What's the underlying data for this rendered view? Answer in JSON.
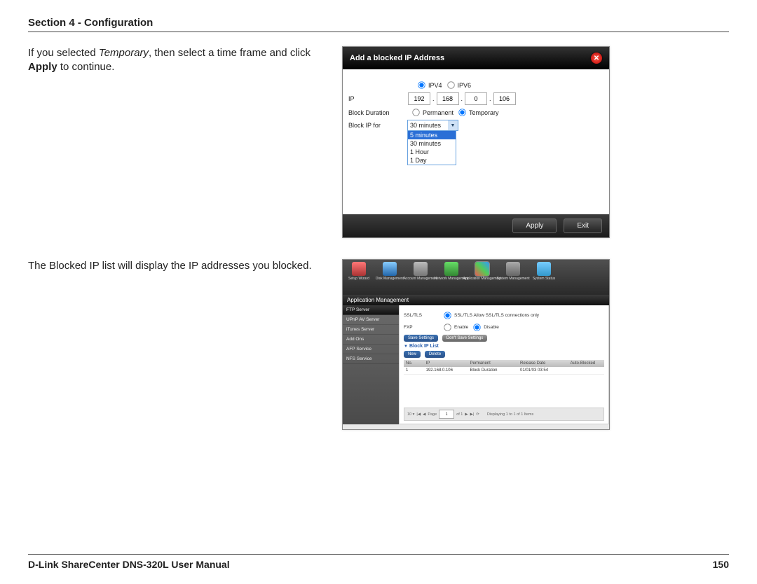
{
  "header": {
    "title": "Section 4 - Configuration"
  },
  "para1": {
    "pre": "If you selected ",
    "temp": "Temporary",
    "mid": ", then select a time frame and click ",
    "apply": "Apply",
    "post": " to continue."
  },
  "para2": "The Blocked IP list will display the IP addresses you blocked.",
  "dialog": {
    "title": "Add a blocked IP Address",
    "ipv4": "IPV4",
    "ipv6": "IPV6",
    "ip_label": "IP",
    "ip": [
      "192",
      "168",
      "0",
      "106"
    ],
    "bd_label": "Block Duration",
    "perm": "Permanent",
    "tempr": "Temporary",
    "bif_label": "Block IP for",
    "selected": "30 minutes",
    "options": [
      "5 minutes",
      "30 minutes",
      "1 Hour",
      "1 Day"
    ],
    "apply": "Apply",
    "exit": "Exit"
  },
  "shot2": {
    "subheader": "Application Management",
    "topitems": [
      "Setup Wizard",
      "Disk Management",
      "Account Management",
      "Network Management",
      "Application Management",
      "System Management",
      "System Status"
    ],
    "side": [
      "FTP Server",
      "UPnP AV Server",
      "iTunes Server",
      "Add Ons",
      "AFP Service",
      "NFS Service"
    ],
    "ssltls_label": "SSL/TLS",
    "ssltls_value": "SSL/TLS Allow SSL/TLS connections only",
    "fxp_label": "FXP",
    "enable": "Enable",
    "disable": "Disable",
    "save": "Save Settings",
    "dontsave": "Don't Save Settings",
    "listtitle": "Block IP List",
    "new": "New",
    "delete": "Delete",
    "cols": [
      "No.",
      "IP",
      "Permanent",
      "Release Date",
      "Auto-Blocked"
    ],
    "row": [
      "1",
      "192.168.0.106",
      "Block Duration",
      "01/01/03 03:54",
      ""
    ],
    "pager": {
      "page_label": "Page",
      "page": "1",
      "of": "of 1",
      "display": "Displaying 1 to 1 of 1 Items"
    }
  },
  "footer": {
    "left": "D-Link ShareCenter DNS-320L User Manual",
    "right": "150"
  }
}
